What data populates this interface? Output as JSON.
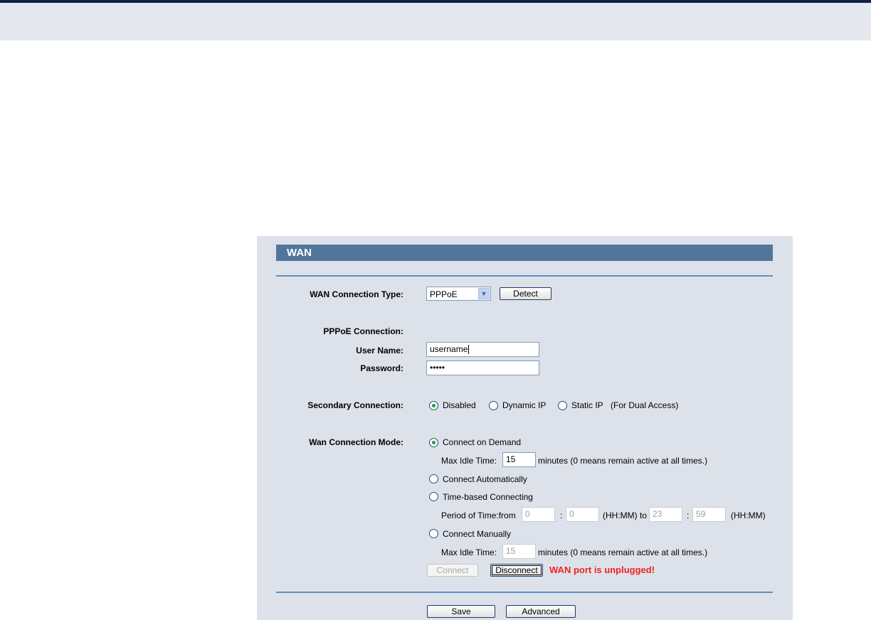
{
  "section_title": "WAN",
  "wan_type": {
    "label": "WAN Connection Type:",
    "value": "PPPoE",
    "detect": "Detect"
  },
  "pppoe": {
    "heading": "PPPoE Connection:",
    "username_label": "User Name:",
    "username": "username",
    "password_label": "Password:",
    "password": "•••••"
  },
  "secondary": {
    "label": "Secondary Connection:",
    "options": [
      "Disabled",
      "Dynamic IP",
      "Static IP"
    ],
    "selected": "Disabled",
    "note": "(For Dual Access)"
  },
  "mode": {
    "label": "Wan Connection Mode:",
    "on_demand": "Connect on Demand",
    "max_idle_label": "Max Idle Time:",
    "max_idle_value": "15",
    "minutes_note": "minutes (0 means remain active at all times.)",
    "auto": "Connect Automatically",
    "time_based": "Time-based Connecting",
    "period_label": "Period of Time:from",
    "from_h": "0",
    "from_m": "0",
    "hhmm_to": "(HH:MM) to",
    "to_h": "23",
    "to_m": "59",
    "hhmm": "(HH:MM)",
    "colon": ":",
    "manual": "Connect Manually",
    "manual_idle_label": "Max Idle Time:",
    "manual_idle_value": "15",
    "manual_minutes_note": "minutes (0 means remain active at all times.)"
  },
  "actions": {
    "connect": "Connect",
    "disconnect": "Disconnect",
    "status": "WAN port is unplugged!"
  },
  "footer": {
    "save": "Save",
    "advanced": "Advanced"
  }
}
